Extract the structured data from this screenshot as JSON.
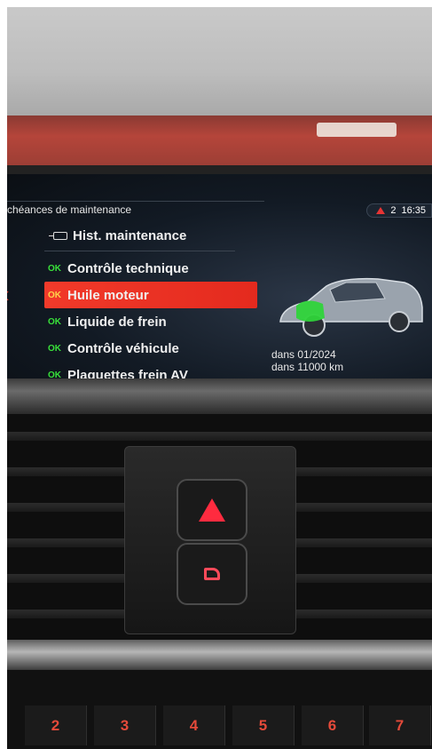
{
  "screen": {
    "title": "chéances de maintenance",
    "status": {
      "warning_count": "2",
      "time": "16:35"
    },
    "menu": {
      "header_label": "Hist. maintenance",
      "items": [
        {
          "ok": "OK",
          "label": "Contrôle technique"
        },
        {
          "ok": "OK",
          "label": "Huile moteur",
          "selected": true
        },
        {
          "ok": "OK",
          "label": "Liquide de frein"
        },
        {
          "ok": "OK",
          "label": "Contrôle véhicule"
        },
        {
          "ok": "OK",
          "label": "Plaquettes frein AV"
        }
      ]
    },
    "detail": {
      "date": "dans 01/2024",
      "distance": "dans 11000 km"
    }
  },
  "keys": [
    "2",
    "3",
    "4",
    "5",
    "6",
    "7"
  ],
  "colors": {
    "accent_red": "#e42a1e",
    "ok_green": "#38e03a",
    "hazard_red": "#ff2b3f"
  }
}
